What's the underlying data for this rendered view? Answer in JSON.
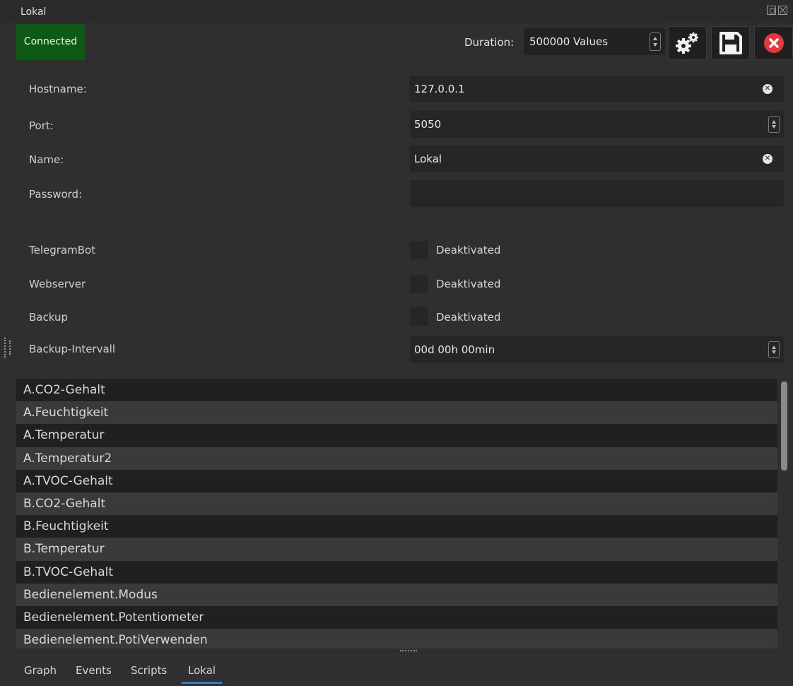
{
  "window": {
    "title": "Lokal"
  },
  "status": {
    "label": "Connected",
    "color": "#0d5a14"
  },
  "toolbar": {
    "duration_label": "Duration:",
    "duration_value": "500000 Values",
    "settings_icon": "gears-icon",
    "save_icon": "floppy-icon",
    "close_icon": "close-circle-icon"
  },
  "form": {
    "hostname_label": "Hostname:",
    "hostname_value": "127.0.0.1",
    "port_label": "Port:",
    "port_value": "5050",
    "name_label": "Name:",
    "name_value": "Lokal",
    "password_label": "Password:",
    "password_value": "",
    "telegram_label": "TelegramBot",
    "telegram_state": "Deaktivated",
    "webserver_label": "Webserver",
    "webserver_state": "Deaktivated",
    "backup_label": "Backup",
    "backup_state": "Deaktivated",
    "backup_interval_label": "Backup-Intervall",
    "backup_interval_value": "00d 00h 00min"
  },
  "variables": [
    "A.CO2-Gehalt",
    "A.Feuchtigkeit",
    "A.Temperatur",
    "A.Temperatur2",
    "A.TVOC-Gehalt",
    "B.CO2-Gehalt",
    "B.Feuchtigkeit",
    "B.Temperatur",
    "B.TVOC-Gehalt",
    "Bedienelement.Modus",
    "Bedienelement.Potentiometer",
    "Bedienelement.PotiVerwenden"
  ],
  "tabs": [
    {
      "label": "Graph"
    },
    {
      "label": "Events"
    },
    {
      "label": "Scripts"
    },
    {
      "label": "Lokal",
      "active": true
    }
  ],
  "colors": {
    "accent": "#2d7fd1",
    "close": "#e8373a"
  }
}
